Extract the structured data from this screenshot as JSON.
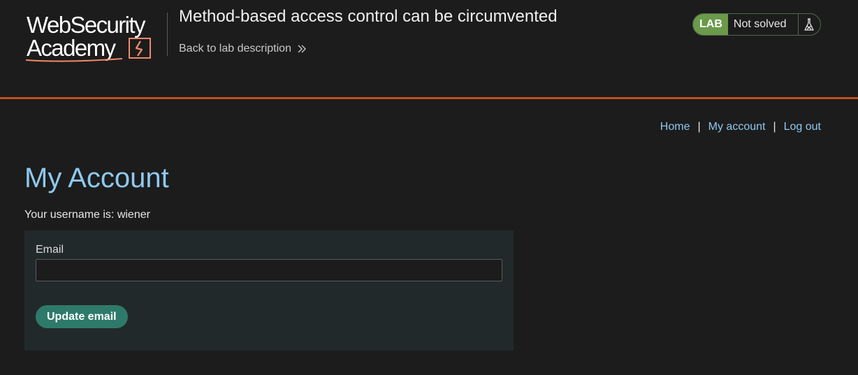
{
  "header": {
    "logo_text_line1": "WebSecurity",
    "logo_text_line2": "Academy",
    "lab_title": "Method-based access control can be circumvented",
    "back_link_label": "Back to lab description",
    "lab_badge": "LAB",
    "lab_status": "Not solved",
    "lab_status_icon": "flask-icon"
  },
  "nav": {
    "home": "Home",
    "separator": "|",
    "my_account": "My account",
    "log_out": "Log out"
  },
  "main": {
    "heading": "My Account",
    "username_line": "Your username is: wiener",
    "email_label": "Email",
    "email_value": "",
    "update_button": "Update email"
  },
  "colors": {
    "background": "#1c1c1c",
    "header_border": "#c14e1c",
    "link": "#8ec9ef",
    "lab_badge": "#6a9a4a",
    "panel": "#22292b",
    "button": "#2e7a6a",
    "logo_accent": "#f08a6a"
  }
}
